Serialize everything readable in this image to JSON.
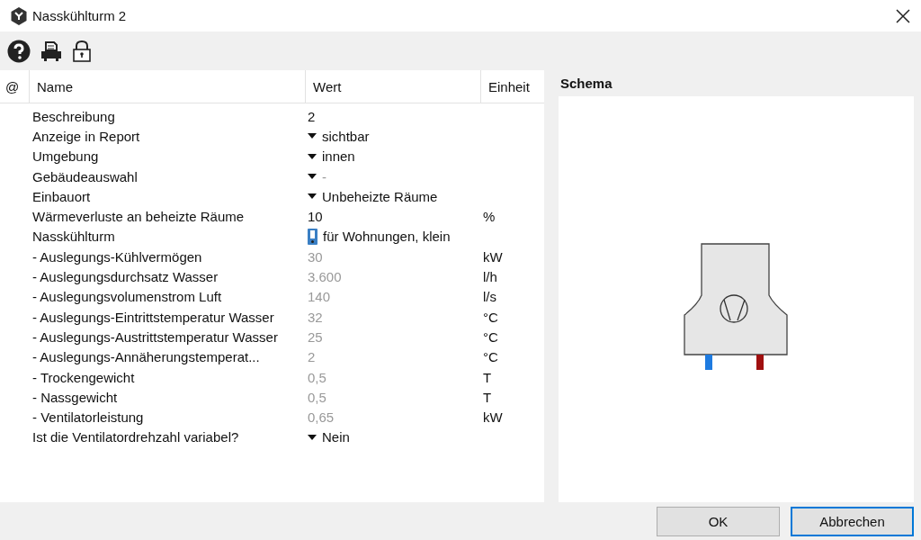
{
  "window": {
    "title": "Nasskühlturm 2"
  },
  "table": {
    "columns": [
      "@",
      "Name",
      "Wert",
      "Einheit"
    ],
    "rows": [
      {
        "name": "Beschreibung",
        "value": "2",
        "kind": "text",
        "disabled": false
      },
      {
        "name": "Anzeige in Report",
        "value": "sichtbar",
        "kind": "dropdown",
        "disabled": false
      },
      {
        "name": "Umgebung",
        "value": "innen",
        "kind": "dropdown",
        "disabled": false
      },
      {
        "name": "Gebäudeauswahl",
        "value": "-",
        "kind": "dropdown",
        "disabled": true
      },
      {
        "name": "Einbauort",
        "value": "Unbeheizte Räume",
        "kind": "dropdown",
        "disabled": false
      },
      {
        "name": "Wärmeverluste an beheizte Räume",
        "value": "10",
        "unit": "%",
        "kind": "text",
        "disabled": false
      },
      {
        "name": "Nasskühlturm",
        "value": "für Wohnungen, klein",
        "kind": "component",
        "disabled": false
      },
      {
        "name": "- Auslegungs-Kühlvermögen",
        "value": "30",
        "unit": "kW",
        "kind": "text",
        "disabled": true
      },
      {
        "name": "- Auslegungsdurchsatz Wasser",
        "value": "3.600",
        "unit": "l/h",
        "kind": "text",
        "disabled": true
      },
      {
        "name": "- Auslegungsvolumenstrom Luft",
        "value": "140",
        "unit": "l/s",
        "kind": "text",
        "disabled": true
      },
      {
        "name": "- Auslegungs-Eintrittstemperatur Wasser",
        "value": "32",
        "unit": "°C",
        "kind": "text",
        "disabled": true
      },
      {
        "name": "- Auslegungs-Austrittstemperatur Wasser",
        "value": "25",
        "unit": "°C",
        "kind": "text",
        "disabled": true
      },
      {
        "name": "- Auslegungs-Annäherungstemperat...",
        "value": "2",
        "unit": "°C",
        "kind": "text",
        "disabled": true
      },
      {
        "name": "- Trockengewicht",
        "value": "0,5",
        "unit": "T",
        "kind": "text",
        "disabled": true
      },
      {
        "name": "- Nassgewicht",
        "value": "0,5",
        "unit": "T",
        "kind": "text",
        "disabled": true
      },
      {
        "name": "- Ventilatorleistung",
        "value": "0,65",
        "unit": "kW",
        "kind": "text",
        "disabled": true
      },
      {
        "name": "Ist die Ventilatordrehzahl variabel?",
        "value": "Nein",
        "kind": "dropdown",
        "disabled": false
      }
    ]
  },
  "schema": {
    "title": "Schema"
  },
  "buttons": [
    {
      "label": "OK",
      "default": false
    },
    {
      "label": "Abbrechen",
      "default": true
    }
  ]
}
